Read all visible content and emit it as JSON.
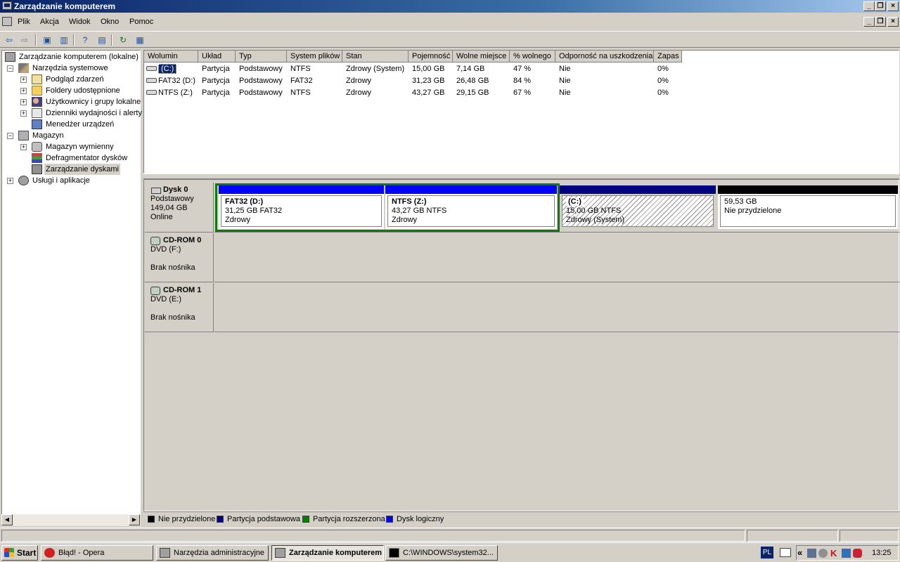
{
  "window": {
    "title": "Zarządzanie komputerem"
  },
  "menu": [
    "Plik",
    "Akcja",
    "Widok",
    "Okno",
    "Pomoc"
  ],
  "tree": [
    {
      "label": "Zarządzanie komputerem (lokalne)",
      "icon": "computer-icon"
    },
    {
      "label": "Narzędzia systemowe",
      "icon": "tools-icon"
    },
    {
      "label": "Podgląd zdarzeń",
      "icon": "event-viewer-icon"
    },
    {
      "label": "Foldery udostępnione",
      "icon": "shared-folder-icon"
    },
    {
      "label": "Użytkownicy i grupy lokalne",
      "icon": "users-icon"
    },
    {
      "label": "Dzienniki wydajności i alerty",
      "icon": "performance-icon"
    },
    {
      "label": "Menedżer urządzeń",
      "icon": "device-manager-icon"
    },
    {
      "label": "Magazyn",
      "icon": "storage-icon"
    },
    {
      "label": "Magazyn wymienny",
      "icon": "removable-storage-icon"
    },
    {
      "label": "Defragmentator dysków",
      "icon": "defrag-icon"
    },
    {
      "label": "Zarządzanie dyskami",
      "icon": "disk-management-icon"
    },
    {
      "label": "Usługi i aplikacje",
      "icon": "services-icon"
    }
  ],
  "volumes": {
    "columns": [
      "Wolumin",
      "Układ",
      "Typ",
      "System plików",
      "Stan",
      "Pojemność",
      "Wolne miejsce",
      "% wolnego",
      "Odporność na uszkodzenia",
      "Zapas"
    ],
    "rows": [
      [
        "(C:)",
        "Partycja",
        "Podstawowy",
        "NTFS",
        "Zdrowy (System)",
        "15,00 GB",
        "7,14 GB",
        "47 %",
        "Nie",
        "0%"
      ],
      [
        "FAT32 (D:)",
        "Partycja",
        "Podstawowy",
        "FAT32",
        "Zdrowy",
        "31,23 GB",
        "26,48 GB",
        "84 %",
        "Nie",
        "0%"
      ],
      [
        "NTFS (Z:)",
        "Partycja",
        "Podstawowy",
        "NTFS",
        "Zdrowy",
        "43,27 GB",
        "29,15 GB",
        "67 %",
        "Nie",
        "0%"
      ]
    ]
  },
  "disks": [
    {
      "name": "Dysk 0",
      "type": "Podstawowy",
      "size": "149,04 GB",
      "status": "Online"
    },
    {
      "name": "CD-ROM 0",
      "type": "DVD (F:)",
      "status": "Brak nośnika"
    },
    {
      "name": "CD-ROM 1",
      "type": "DVD (E:)",
      "status": "Brak nośnika"
    }
  ],
  "partitions": [
    {
      "title": "FAT32  (D:)",
      "size": "31,25 GB FAT32",
      "status": "Zdrowy"
    },
    {
      "title": "NTFS  (Z:)",
      "size": "43,27 GB NTFS",
      "status": "Zdrowy"
    },
    {
      "title": "(C:)",
      "size": "15,00 GB NTFS",
      "status": "Zdrowy (System)"
    },
    {
      "title": "",
      "size": "59,53 GB",
      "status": "Nie przydzielone"
    }
  ],
  "legend": [
    {
      "label": "Nie przydzielone",
      "color": "#000000"
    },
    {
      "label": "Partycja podstawowa",
      "color": "#000080"
    },
    {
      "label": "Partycja rozszerzona",
      "color": "#008000"
    },
    {
      "label": "Dysk logiczny",
      "color": "#0000ff"
    }
  ],
  "taskbar": {
    "start": "Start",
    "tasks": [
      "Błąd! - Opera",
      "Narzędzia administracyjne",
      "Zarządzanie komputerem",
      "C:\\WINDOWS\\system32..."
    ],
    "lang": "PL",
    "chevron": "«",
    "clock": "13:25"
  }
}
